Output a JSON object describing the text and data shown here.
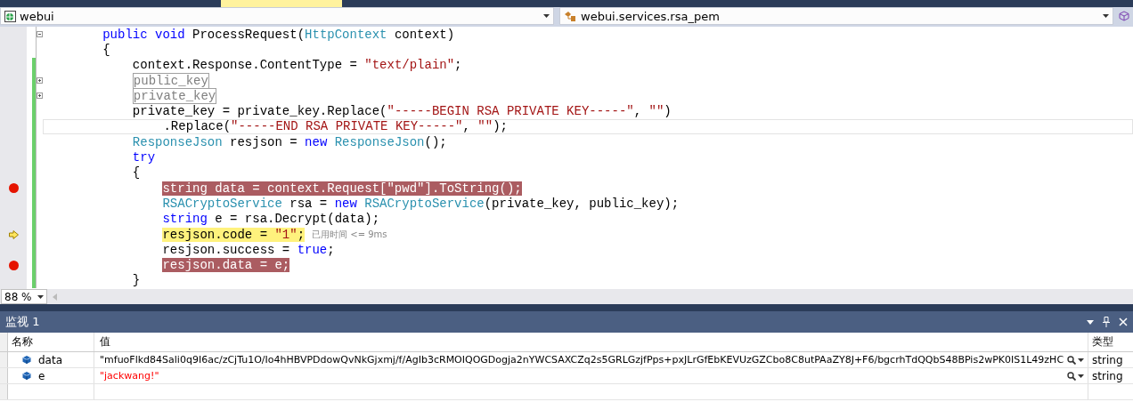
{
  "navigation_bar": {
    "project": "webui",
    "type": "webui.services.rsa_pem"
  },
  "editor": {
    "zoom": "88 %",
    "lines": [
      {
        "kind": "member",
        "segments": [
          {
            "kind": "keyword",
            "text": "public void "
          },
          {
            "kind": "plain",
            "text": "ProcessRequest("
          },
          {
            "kind": "type",
            "text": "HttpContext"
          },
          {
            "kind": "plain",
            "text": " context)"
          }
        ],
        "breakpoint": false,
        "current": false,
        "changed": false,
        "collapsed": false
      },
      {
        "kind": "member",
        "segments": [
          {
            "kind": "plain",
            "text": "{"
          }
        ],
        "breakpoint": false,
        "current": false,
        "changed": false
      },
      {
        "kind": "body",
        "segments": [
          {
            "kind": "plain",
            "text": "context.Response.ContentType = "
          },
          {
            "kind": "string",
            "text": "\"text/plain\""
          },
          {
            "kind": "plain",
            "text": ";"
          }
        ],
        "breakpoint": false,
        "current": false,
        "changed": true
      },
      {
        "kind": "body",
        "segments": [
          {
            "kind": "plain",
            "text": "public_key"
          }
        ],
        "breakpoint": false,
        "current": false,
        "changed": true,
        "collapsed": true
      },
      {
        "kind": "body",
        "segments": [
          {
            "kind": "plain",
            "text": "private_key"
          }
        ],
        "breakpoint": false,
        "current": false,
        "changed": true,
        "collapsed": true
      },
      {
        "kind": "body",
        "segments": [
          {
            "kind": "plain",
            "text": "private_key = private_key.Replace("
          },
          {
            "kind": "string",
            "text": "\"-----BEGIN RSA PRIVATE KEY-----\""
          },
          {
            "kind": "plain",
            "text": ", "
          },
          {
            "kind": "string",
            "text": "\"\""
          },
          {
            "kind": "plain",
            "text": ")"
          }
        ],
        "breakpoint": false,
        "current": false,
        "changed": true
      },
      {
        "kind": "continuation",
        "segments": [
          {
            "kind": "plain",
            "text": ".Replace("
          },
          {
            "kind": "string",
            "text": "\"-----END RSA PRIVATE KEY-----\""
          },
          {
            "kind": "plain",
            "text": ", "
          },
          {
            "kind": "string",
            "text": "\"\""
          },
          {
            "kind": "plain",
            "text": ");"
          }
        ],
        "breakpoint": false,
        "current": false,
        "changed": true,
        "caret_line": true
      },
      {
        "kind": "body",
        "segments": [
          {
            "kind": "type",
            "text": "ResponseJson"
          },
          {
            "kind": "plain",
            "text": " resjson = "
          },
          {
            "kind": "keyword",
            "text": "new "
          },
          {
            "kind": "type",
            "text": "ResponseJson"
          },
          {
            "kind": "plain",
            "text": "();"
          }
        ],
        "breakpoint": false,
        "current": false,
        "changed": true
      },
      {
        "kind": "body",
        "segments": [
          {
            "kind": "keyword",
            "text": "try"
          }
        ],
        "breakpoint": false,
        "current": false,
        "changed": true
      },
      {
        "kind": "body",
        "segments": [
          {
            "kind": "plain",
            "text": "{"
          }
        ],
        "breakpoint": false,
        "current": false,
        "changed": true
      },
      {
        "kind": "nested",
        "segments": [
          {
            "kind": "keyword",
            "text": "string "
          },
          {
            "kind": "plain",
            "text": "data = context.Request["
          },
          {
            "kind": "string",
            "text": "\"pwd\""
          },
          {
            "kind": "plain",
            "text": "].ToString();"
          }
        ],
        "breakpoint": true,
        "current": false,
        "changed": true
      },
      {
        "kind": "nested",
        "segments": [
          {
            "kind": "type",
            "text": "RSACryptoService"
          },
          {
            "kind": "plain",
            "text": " rsa = "
          },
          {
            "kind": "keyword",
            "text": "new "
          },
          {
            "kind": "type",
            "text": "RSACryptoService"
          },
          {
            "kind": "plain",
            "text": "(private_key, public_key);"
          }
        ],
        "breakpoint": false,
        "current": false,
        "changed": true
      },
      {
        "kind": "nested",
        "segments": [
          {
            "kind": "keyword",
            "text": "string "
          },
          {
            "kind": "plain",
            "text": "e = rsa.Decrypt(data);"
          }
        ],
        "breakpoint": false,
        "current": false,
        "changed": true
      },
      {
        "kind": "nested",
        "segments": [
          {
            "kind": "plain",
            "text": "resjson.code = "
          },
          {
            "kind": "string",
            "text": "\"1\""
          },
          {
            "kind": "plain",
            "text": ";"
          }
        ],
        "breakpoint": false,
        "current": true,
        "changed": true,
        "elapsed": "已用时间 <= 9ms"
      },
      {
        "kind": "nested",
        "segments": [
          {
            "kind": "plain",
            "text": "resjson.success = "
          },
          {
            "kind": "keyword",
            "text": "true"
          },
          {
            "kind": "plain",
            "text": ";"
          }
        ],
        "breakpoint": false,
        "current": false,
        "changed": true
      },
      {
        "kind": "nested",
        "segments": [
          {
            "kind": "plain",
            "text": "resjson.data = e;"
          }
        ],
        "breakpoint": true,
        "current": false,
        "changed": true
      },
      {
        "kind": "body",
        "segments": [
          {
            "kind": "plain",
            "text": "}"
          }
        ],
        "breakpoint": false,
        "current": false,
        "changed": true
      }
    ]
  },
  "watch": {
    "title": "监视 1",
    "columns": [
      "名称",
      "值",
      "类型"
    ],
    "rows": [
      {
        "name": "data",
        "value": "\"mfuoFlkd84Sali0q9I6ac/zCjTu1O/Io4hHBVPDdowQvNkGjxmj/f/AgIb3cRMOIQOGDogja2nYWCSAXCZq2s5GRLGzjfPps+pxJLrGfEbKEVUzGZCbo8C8utPAaZY8J+F6/bgcrhTdQQbS48BPis2wPK0IS1L49zHC",
        "type": "string",
        "changed": false
      },
      {
        "name": "e",
        "value": "\"jackwang!\"",
        "type": "string",
        "changed": true
      }
    ]
  }
}
